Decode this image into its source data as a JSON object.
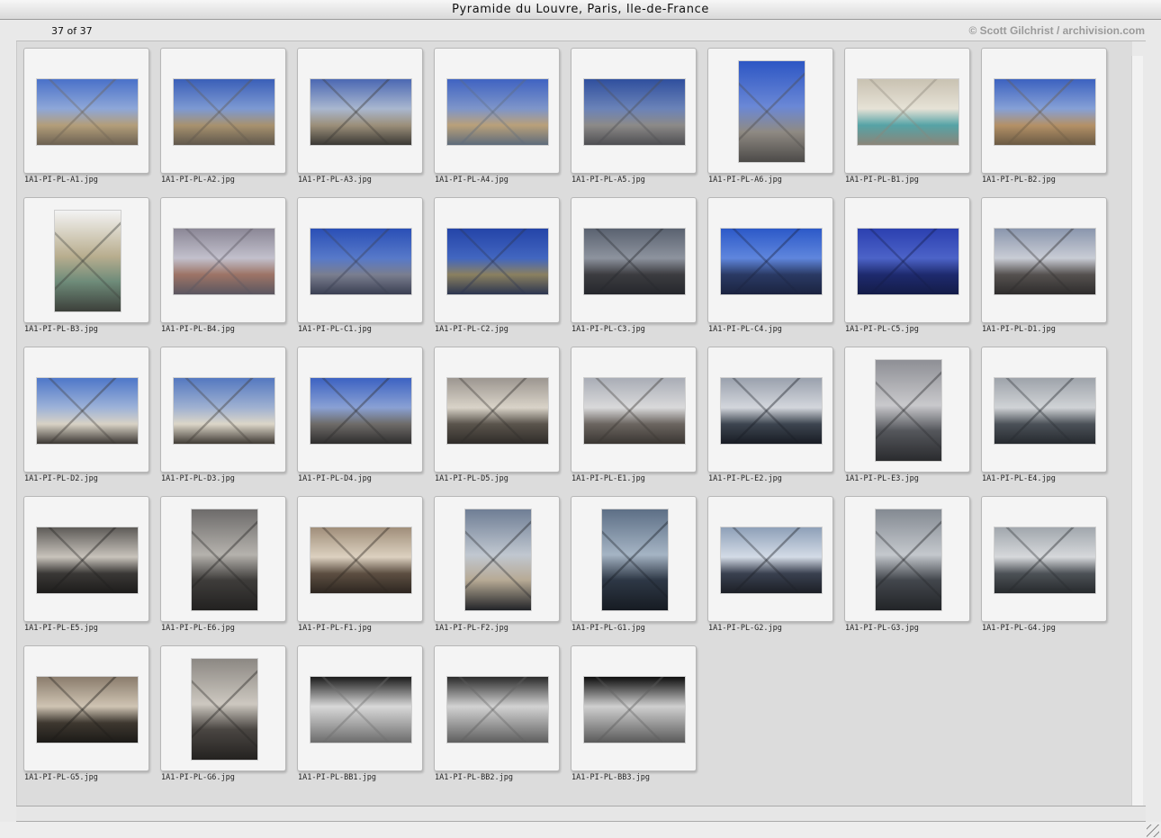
{
  "window": {
    "title": "Pyramide du Louvre, Paris, Ile-de-France"
  },
  "header": {
    "count": "37 of 37",
    "credit": "© Scott Gilchrist / archivision.com"
  },
  "thumbnails": [
    {
      "name": "1A1-PI-PL-A1.jpg",
      "orientation": "landscape",
      "palette": [
        "#4a71c9",
        "#8ea7d8",
        "#b39e7a",
        "#6c6152"
      ]
    },
    {
      "name": "1A1-PI-PL-A2.jpg",
      "orientation": "landscape",
      "palette": [
        "#3a5fb8",
        "#7d99d2",
        "#a8926f",
        "#5f574c"
      ]
    },
    {
      "name": "1A1-PI-PL-A3.jpg",
      "orientation": "landscape",
      "palette": [
        "#4b68b3",
        "#a9b7cf",
        "#9c8f7a",
        "#3a3834"
      ]
    },
    {
      "name": "1A1-PI-PL-A4.jpg",
      "orientation": "landscape",
      "palette": [
        "#3f63c2",
        "#7e95c9",
        "#b9a07a",
        "#5e6b7b"
      ]
    },
    {
      "name": "1A1-PI-PL-A5.jpg",
      "orientation": "landscape",
      "palette": [
        "#2f4f9e",
        "#6b83b8",
        "#8c8a88",
        "#4e4e52"
      ]
    },
    {
      "name": "1A1-PI-PL-A6.jpg",
      "orientation": "portrait",
      "palette": [
        "#2d56c4",
        "#6a88d6",
        "#8f8a83",
        "#4c4a48"
      ]
    },
    {
      "name": "1A1-PI-PL-B1.jpg",
      "orientation": "landscape",
      "palette": [
        "#c9c2b2",
        "#e6e2d6",
        "#56a3a6",
        "#8b8579"
      ]
    },
    {
      "name": "1A1-PI-PL-B2.jpg",
      "orientation": "landscape",
      "palette": [
        "#3c62c0",
        "#86a0d6",
        "#b49167",
        "#6a5a44"
      ]
    },
    {
      "name": "1A1-PI-PL-B3.jpg",
      "orientation": "portrait",
      "palette": [
        "#f3f3f3",
        "#b9ae8f",
        "#6f8c7a",
        "#3c3f3a"
      ]
    },
    {
      "name": "1A1-PI-PL-B4.jpg",
      "orientation": "landscape",
      "palette": [
        "#8b8796",
        "#c2c0cc",
        "#9d7466",
        "#5a5660"
      ]
    },
    {
      "name": "1A1-PI-PL-C1.jpg",
      "orientation": "landscape",
      "palette": [
        "#2a4fb6",
        "#5779c9",
        "#7a7e8f",
        "#3a3f52"
      ]
    },
    {
      "name": "1A1-PI-PL-C2.jpg",
      "orientation": "landscape",
      "palette": [
        "#2444a8",
        "#4266c0",
        "#8a8060",
        "#2c3550"
      ]
    },
    {
      "name": "1A1-PI-PL-C3.jpg",
      "orientation": "landscape",
      "palette": [
        "#5a6270",
        "#8d939e",
        "#3c3c40",
        "#25272c"
      ]
    },
    {
      "name": "1A1-PI-PL-C4.jpg",
      "orientation": "landscape",
      "palette": [
        "#2c59c8",
        "#5f86dd",
        "#2a3a64",
        "#1b2340"
      ]
    },
    {
      "name": "1A1-PI-PL-C5.jpg",
      "orientation": "landscape",
      "palette": [
        "#2b40b0",
        "#4c63c8",
        "#1e2a6e",
        "#141c48"
      ]
    },
    {
      "name": "1A1-PI-PL-D1.jpg",
      "orientation": "landscape",
      "palette": [
        "#8a96ad",
        "#c9ccd5",
        "#55514f",
        "#2e2c2c"
      ]
    },
    {
      "name": "1A1-PI-PL-D2.jpg",
      "orientation": "landscape",
      "palette": [
        "#4e77c9",
        "#9db2d8",
        "#d8d2c5",
        "#3b3733"
      ]
    },
    {
      "name": "1A1-PI-PL-D3.jpg",
      "orientation": "landscape",
      "palette": [
        "#5478c0",
        "#9fb1d1",
        "#dcd6c8",
        "#403b35"
      ]
    },
    {
      "name": "1A1-PI-PL-D4.jpg",
      "orientation": "landscape",
      "palette": [
        "#3c62c2",
        "#8aa1d4",
        "#6e6b68",
        "#2e2d2d"
      ]
    },
    {
      "name": "1A1-PI-PL-D5.jpg",
      "orientation": "landscape",
      "palette": [
        "#9c9690",
        "#d9d3c8",
        "#5a544c",
        "#2f2c29"
      ]
    },
    {
      "name": "1A1-PI-PL-E1.jpg",
      "orientation": "landscape",
      "palette": [
        "#a9adb6",
        "#d9d9da",
        "#6b6560",
        "#3a3632"
      ]
    },
    {
      "name": "1A1-PI-PL-E2.jpg",
      "orientation": "landscape",
      "palette": [
        "#9aa1ad",
        "#d3d6dc",
        "#3d4550",
        "#181c24"
      ]
    },
    {
      "name": "1A1-PI-PL-E3.jpg",
      "orientation": "portrait",
      "palette": [
        "#8e8f95",
        "#c9c9cc",
        "#55575c",
        "#2a2b2e"
      ]
    },
    {
      "name": "1A1-PI-PL-E4.jpg",
      "orientation": "landscape",
      "palette": [
        "#9ea3aa",
        "#d0d3d6",
        "#4b5158",
        "#262a2f"
      ]
    },
    {
      "name": "1A1-PI-PL-E5.jpg",
      "orientation": "landscape",
      "palette": [
        "#5e5b58",
        "#c8c3bb",
        "#3a3836",
        "#1d1c1b"
      ]
    },
    {
      "name": "1A1-PI-PL-E6.jpg",
      "orientation": "portrait",
      "palette": [
        "#6d6b6a",
        "#b5b2ad",
        "#3f3d3b",
        "#222120"
      ]
    },
    {
      "name": "1A1-PI-PL-F1.jpg",
      "orientation": "landscape",
      "palette": [
        "#a08e7a",
        "#dcd1c0",
        "#5d4f42",
        "#2d2620"
      ]
    },
    {
      "name": "1A1-PI-PL-F2.jpg",
      "orientation": "portrait",
      "palette": [
        "#6f7e95",
        "#c0c7d0",
        "#b7aa95",
        "#222428"
      ]
    },
    {
      "name": "1A1-PI-PL-G1.jpg",
      "orientation": "portrait",
      "palette": [
        "#5d6f86",
        "#a5b4c4",
        "#2e3846",
        "#161b22"
      ]
    },
    {
      "name": "1A1-PI-PL-G2.jpg",
      "orientation": "landscape",
      "palette": [
        "#8ea0b8",
        "#d3dbe6",
        "#3a4150",
        "#1c1f26"
      ]
    },
    {
      "name": "1A1-PI-PL-G3.jpg",
      "orientation": "portrait",
      "palette": [
        "#848a92",
        "#c4c8cd",
        "#43474d",
        "#222427"
      ]
    },
    {
      "name": "1A1-PI-PL-G4.jpg",
      "orientation": "landscape",
      "palette": [
        "#a1a7ad",
        "#d6d8db",
        "#4d5257",
        "#26292c"
      ]
    },
    {
      "name": "1A1-PI-PL-G5.jpg",
      "orientation": "landscape",
      "palette": [
        "#8a7c6c",
        "#cfc4b3",
        "#3e3830",
        "#1c1a17"
      ]
    },
    {
      "name": "1A1-PI-PL-G6.jpg",
      "orientation": "portrait",
      "palette": [
        "#8c8883",
        "#cdc8c0",
        "#4a4642",
        "#242220"
      ]
    },
    {
      "name": "1A1-PI-PL-BB1.jpg",
      "orientation": "landscape",
      "palette": [
        "#1a1a1a",
        "#d8d8d8",
        "#a8a8a8",
        "#6c6c6c"
      ]
    },
    {
      "name": "1A1-PI-PL-BB2.jpg",
      "orientation": "landscape",
      "palette": [
        "#2a2a2a",
        "#d2d2d2",
        "#9e9e9e",
        "#5e5e5e"
      ]
    },
    {
      "name": "1A1-PI-PL-BB3.jpg",
      "orientation": "landscape",
      "palette": [
        "#0d0d0d",
        "#cfcfcf",
        "#9a9a9a",
        "#5a5a5a"
      ]
    }
  ]
}
